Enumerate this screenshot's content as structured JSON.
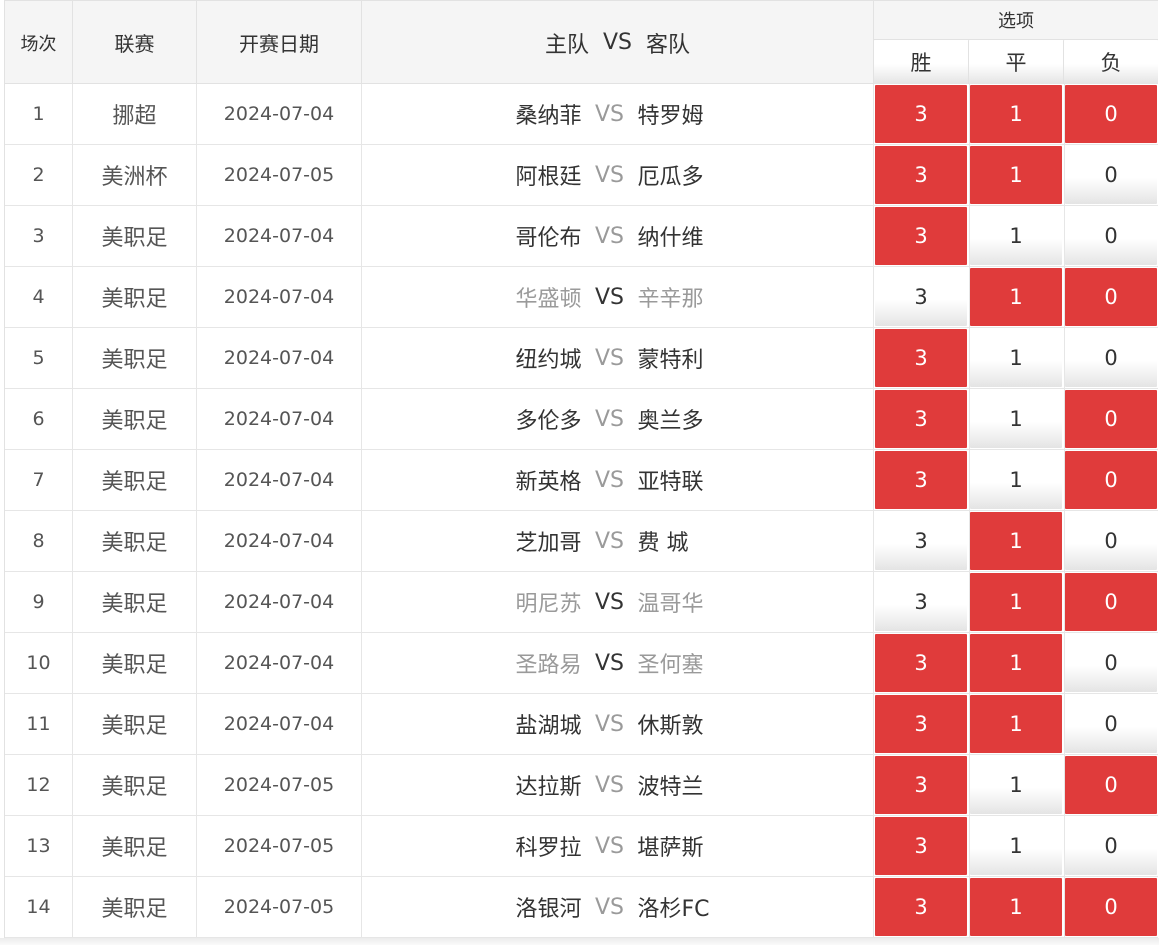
{
  "header": {
    "col_number": "场次",
    "col_league": "联赛",
    "col_date": "开赛日期",
    "col_home": "主队",
    "col_vs": "VS",
    "col_away": "客队",
    "col_options": "选项",
    "opt_win": "胜",
    "opt_draw": "平",
    "opt_loss": "负"
  },
  "colors": {
    "selected": "#e03b3b",
    "dim_text": "#9a9a9a"
  },
  "vs_label": "VS",
  "options": [
    "3",
    "1",
    "0"
  ],
  "rows": [
    {
      "num": "1",
      "league": "挪超",
      "date": "2024-07-04",
      "home": "桑纳菲",
      "away": "特罗姆",
      "dim": false,
      "sel": [
        true,
        true,
        true
      ]
    },
    {
      "num": "2",
      "league": "美洲杯",
      "date": "2024-07-05",
      "home": "阿根廷",
      "away": "厄瓜多",
      "dim": false,
      "sel": [
        true,
        true,
        false
      ]
    },
    {
      "num": "3",
      "league": "美职足",
      "date": "2024-07-04",
      "home": "哥伦布",
      "away": "纳什维",
      "dim": false,
      "sel": [
        true,
        false,
        false
      ]
    },
    {
      "num": "4",
      "league": "美职足",
      "date": "2024-07-04",
      "home": "华盛顿",
      "away": "辛辛那",
      "dim": true,
      "sel": [
        false,
        true,
        true
      ]
    },
    {
      "num": "5",
      "league": "美职足",
      "date": "2024-07-04",
      "home": "纽约城",
      "away": "蒙特利",
      "dim": false,
      "sel": [
        true,
        false,
        false
      ]
    },
    {
      "num": "6",
      "league": "美职足",
      "date": "2024-07-04",
      "home": "多伦多",
      "away": "奥兰多",
      "dim": false,
      "sel": [
        true,
        false,
        true
      ]
    },
    {
      "num": "7",
      "league": "美职足",
      "date": "2024-07-04",
      "home": "新英格",
      "away": "亚特联",
      "dim": false,
      "sel": [
        true,
        false,
        true
      ]
    },
    {
      "num": "8",
      "league": "美职足",
      "date": "2024-07-04",
      "home": "芝加哥",
      "away": "费 城",
      "dim": false,
      "sel": [
        false,
        true,
        false
      ]
    },
    {
      "num": "9",
      "league": "美职足",
      "date": "2024-07-04",
      "home": "明尼苏",
      "away": "温哥华",
      "dim": true,
      "sel": [
        false,
        true,
        true
      ]
    },
    {
      "num": "10",
      "league": "美职足",
      "date": "2024-07-04",
      "home": "圣路易",
      "away": "圣何塞",
      "dim": true,
      "sel": [
        true,
        true,
        false
      ]
    },
    {
      "num": "11",
      "league": "美职足",
      "date": "2024-07-04",
      "home": "盐湖城",
      "away": "休斯敦",
      "dim": false,
      "sel": [
        true,
        true,
        false
      ]
    },
    {
      "num": "12",
      "league": "美职足",
      "date": "2024-07-05",
      "home": "达拉斯",
      "away": "波特兰",
      "dim": false,
      "sel": [
        true,
        false,
        true
      ]
    },
    {
      "num": "13",
      "league": "美职足",
      "date": "2024-07-05",
      "home": "科罗拉",
      "away": "堪萨斯",
      "dim": false,
      "sel": [
        true,
        false,
        false
      ]
    },
    {
      "num": "14",
      "league": "美职足",
      "date": "2024-07-05",
      "home": "洛银河",
      "away": "洛杉FC",
      "dim": false,
      "sel": [
        true,
        true,
        true
      ]
    }
  ]
}
